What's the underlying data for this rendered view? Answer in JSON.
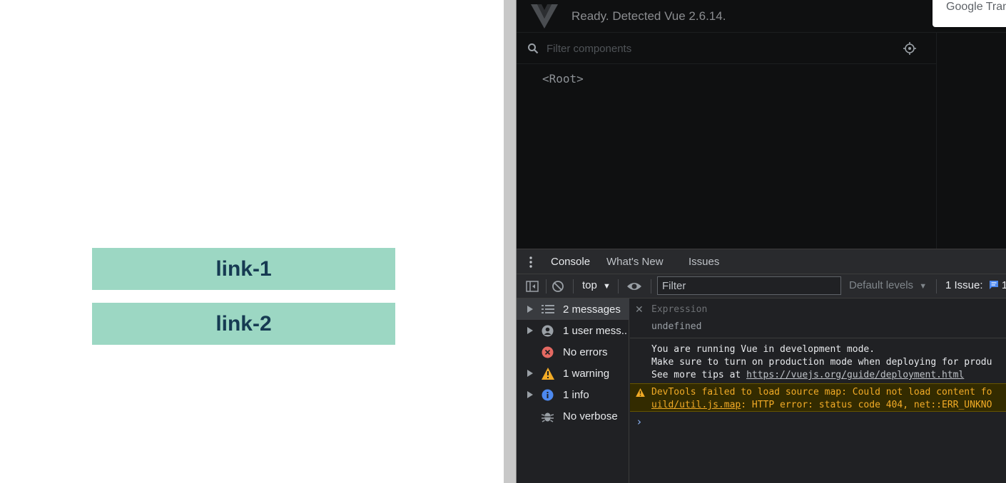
{
  "page": {
    "links": [
      "link-1",
      "link-2"
    ],
    "link_color": "#9cd7c3"
  },
  "vue_devtools": {
    "status": "Ready. Detected Vue 2.6.14.",
    "filter_placeholder": "Filter components",
    "root_node": "<Root>",
    "google_translate_popup": "Google Trans"
  },
  "drawer": {
    "tabs": [
      "Console",
      "What's New",
      "Issues"
    ],
    "active_tab": "Console"
  },
  "toolbar": {
    "context": "top",
    "filter_placeholder": "Filter",
    "levels": "Default levels",
    "issues": "1 Issue:",
    "issues_count": "1"
  },
  "sidebar": {
    "items": [
      {
        "label": "2 messages",
        "icon": "list-icon"
      },
      {
        "label": "1 user mess...",
        "icon": "user-icon"
      },
      {
        "label": "No errors",
        "icon": "error-icon"
      },
      {
        "label": "1 warning",
        "icon": "warning-icon"
      },
      {
        "label": "1 info",
        "icon": "info-icon"
      },
      {
        "label": "No verbose",
        "icon": "verbose-icon"
      }
    ]
  },
  "console": {
    "expression_label": "Expression",
    "expression_value": "undefined",
    "log_line_1": "You are running Vue in development mode.",
    "log_line_2": "Make sure to turn on production mode when deploying for produ",
    "log_line_3_prefix": "See more tips at ",
    "log_line_3_link": "https://vuejs.org/guide/deployment.html",
    "warning_line_1": "DevTools failed to load source map: Could not load content fo",
    "warning_line_2_link": "uild/util.js.map",
    "warning_line_2_rest": ": HTTP error: status code 404, net::ERR_UNKNO"
  },
  "colors": {
    "accent": "#8ab4f8",
    "warning": "#f2ab26",
    "error": "#e46962",
    "info": "#4d89f0"
  }
}
